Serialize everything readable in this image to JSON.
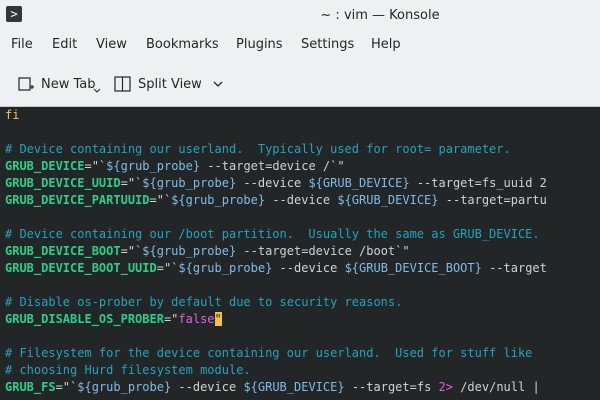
{
  "window": {
    "title": "~ : vim — Konsole"
  },
  "menu": [
    "File",
    "Edit",
    "View",
    "Bookmarks",
    "Plugins",
    "Settings",
    "Help"
  ],
  "toolbar": {
    "new_tab": "New Tab",
    "split_view": "Split View"
  },
  "terminal": {
    "l0": "fi",
    "l2": "# Device containing our userland.  Typically used for root= parameter.",
    "l3a": "GRUB_DEVICE",
    "l3b": "=\"`",
    "l3c": "${grub_probe}",
    "l3d": " --target=device /`\"",
    "l4a": "GRUB_DEVICE_UUID",
    "l4b": "=\"`",
    "l4c": "${grub_probe}",
    "l4d": " --device ",
    "l4e": "${GRUB_DEVICE}",
    "l4f": " --target=fs_uuid 2",
    "l5a": "GRUB_DEVICE_PARTUUID",
    "l5b": "=\"`",
    "l5c": "${grub_probe}",
    "l5d": " --device ",
    "l5e": "${GRUB_DEVICE}",
    "l5f": " --target=partu",
    "l7": "# Device containing our /boot partition.  Usually the same as GRUB_DEVICE.",
    "l8a": "GRUB_DEVICE_BOOT",
    "l8b": "=\"`",
    "l8c": "${grub_probe}",
    "l8d": " --target=device /boot`\"",
    "l9a": "GRUB_DEVICE_BOOT_UUID",
    "l9b": "=\"`",
    "l9c": "${grub_probe}",
    "l9d": " --device ",
    "l9e": "${GRUB_DEVICE_BOOT}",
    "l9f": " --target",
    "l11": "# Disable os-prober by default due to security reasons.",
    "l12a": "GRUB_DISABLE_OS_PROBER",
    "l12b": "=\"",
    "l12c": "false",
    "l12d": "\"",
    "l14": "# Filesystem for the device containing our userland.  Used for stuff like",
    "l15": "# choosing Hurd filesystem module.",
    "l16a": "GRUB_FS",
    "l16b": "=\"`",
    "l16c": "${grub_probe}",
    "l16d": " --device ",
    "l16e": "${GRUB_DEVICE}",
    "l16f": " --target=fs ",
    "l16g": "2>",
    "l16h": " /dev/null |"
  }
}
